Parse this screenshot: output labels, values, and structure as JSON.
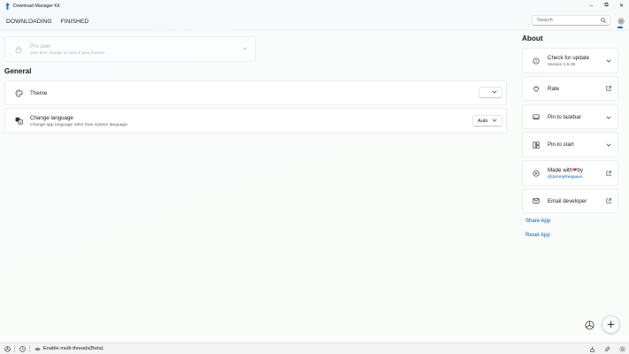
{
  "window": {
    "title": "Download Manager Kit",
    "controls": {
      "minimize": "–",
      "maximize": "⧉",
      "close": "✕"
    }
  },
  "tabs": [
    "DOWNLOADING",
    "FINISHED"
  ],
  "search": {
    "placeholder": "Search",
    "icon": "search-icon"
  },
  "pro": {
    "title": "Pro user",
    "subtitle": "One time charge to unlock plus feature."
  },
  "general": {
    "heading": "General",
    "theme": {
      "label": "Theme",
      "value": ""
    },
    "language": {
      "label": "Change language",
      "description": "Change app language other than system language.",
      "value": "Auto"
    }
  },
  "about": {
    "heading": "About",
    "items": [
      {
        "label": "Check for update",
        "sub": "Version 1.5.35",
        "icon": "info-icon",
        "action": "chevron-down-icon"
      },
      {
        "label": "Rate",
        "icon": "rate-icon",
        "action": "external-link-icon"
      },
      {
        "label": "Pin to taskbar",
        "icon": "taskbar-icon",
        "action": "chevron-down-icon"
      },
      {
        "label": "Pin to start",
        "icon": "pin-start-icon",
        "action": "chevron-down-icon"
      },
      {
        "label_prefix": "Made with",
        "heart": "❤",
        "label_suffix": "by",
        "sub": "@JimmyRespawn",
        "icon": "play-circle-icon",
        "action": "external-link-icon"
      },
      {
        "label": "Email developer",
        "icon": "mail-icon",
        "action": "external-link-icon"
      }
    ],
    "links": {
      "share": "Share App",
      "reset": "Reset App"
    }
  },
  "status": {
    "multithread_label": "Enable multi-threads(Beta)"
  },
  "colors": {
    "accent": "#0b5cad",
    "heart": "#d7263d",
    "link": "#0f5aa6"
  }
}
